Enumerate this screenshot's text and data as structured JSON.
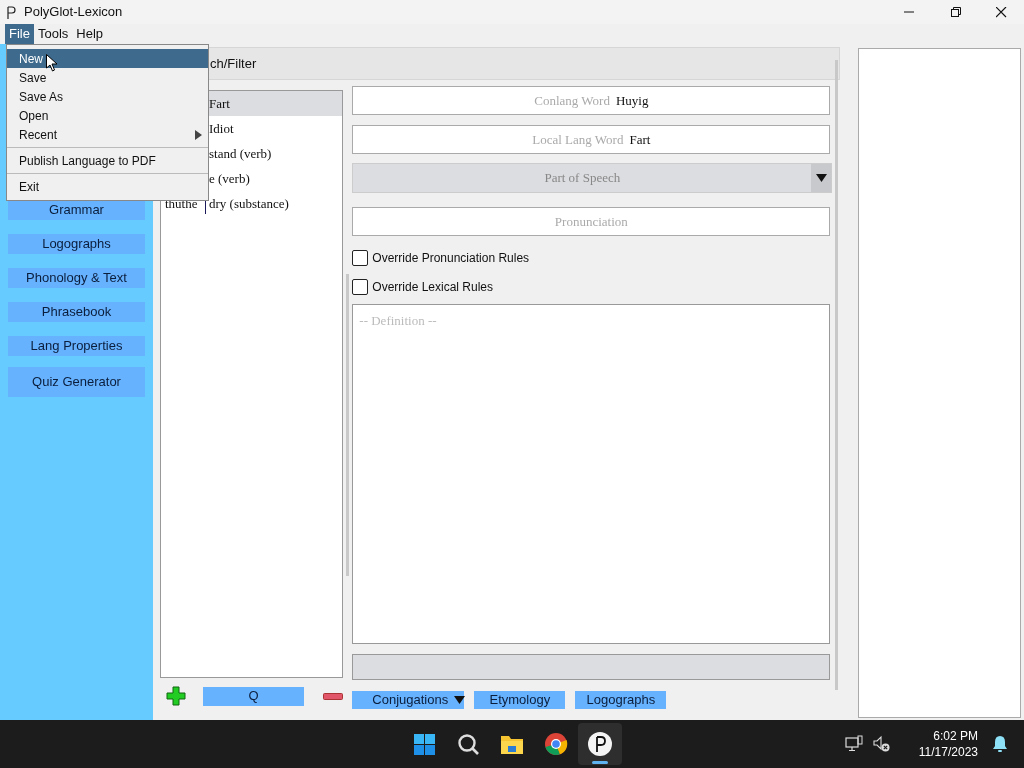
{
  "window": {
    "title": "PolyGlot-Lexicon"
  },
  "menu_bar": [
    {
      "label": "File",
      "selected": true
    },
    {
      "label": "Tools",
      "selected": false
    },
    {
      "label": "Help",
      "selected": false
    }
  ],
  "file_menu": [
    {
      "kind": "item",
      "label": "New",
      "selected": true
    },
    {
      "kind": "item",
      "label": "Save",
      "selected": false
    },
    {
      "kind": "item",
      "label": "Save As",
      "selected": false
    },
    {
      "kind": "item",
      "label": "Open",
      "selected": false
    },
    {
      "kind": "submenu",
      "label": "Recent",
      "selected": false
    },
    {
      "kind": "separator"
    },
    {
      "kind": "item",
      "label": "Publish Language to PDF",
      "selected": false
    },
    {
      "kind": "separator"
    },
    {
      "kind": "item",
      "label": "Exit",
      "selected": false
    }
  ],
  "sidebar": {
    "buttons": [
      "Grammar",
      "Logographs",
      "Phonology & Text",
      "Phrasebook",
      "Lang Properties",
      "Quiz Generator"
    ]
  },
  "search_header": "ch/Filter",
  "word_list": [
    {
      "local": "Fart",
      "selected": true
    },
    {
      "local": "Idiot",
      "selected": false
    },
    {
      "local": "stand (verb)",
      "selected": false
    },
    {
      "local": "e (verb)",
      "selected": false
    },
    {
      "conword": "thuthe",
      "local": "dry (substance)",
      "selected": false
    }
  ],
  "list_actions": {
    "search_button": "Q"
  },
  "form": {
    "conlang_word": {
      "placeholder": "Conlang Word",
      "value": "Huyig"
    },
    "local_word": {
      "placeholder": "Local Lang Word",
      "value": "Fart"
    },
    "part_of_speech": {
      "placeholder": "Part of Speech"
    },
    "pronunciation": {
      "placeholder": "Pronunciation"
    },
    "checkboxes": [
      {
        "label": "Override Pronunciation Rules",
        "checked": false
      },
      {
        "label": "Override Lexical Rules",
        "checked": false
      }
    ],
    "definition": {
      "placeholder": "-- Definition --"
    },
    "buttons": [
      {
        "label": "Conjugations",
        "kind": "dropdown"
      },
      {
        "label": "Etymology",
        "kind": "plain"
      },
      {
        "label": "Logographs",
        "kind": "plain"
      }
    ]
  },
  "taskbar": {
    "apps": [
      {
        "kind": "start",
        "selected": false
      },
      {
        "kind": "search",
        "selected": false
      },
      {
        "kind": "folder",
        "selected": false
      },
      {
        "kind": "browser",
        "selected": false
      },
      {
        "kind": "polyglot",
        "selected": true
      }
    ],
    "time": "6:02 PM",
    "date": "11/17/2023"
  }
}
